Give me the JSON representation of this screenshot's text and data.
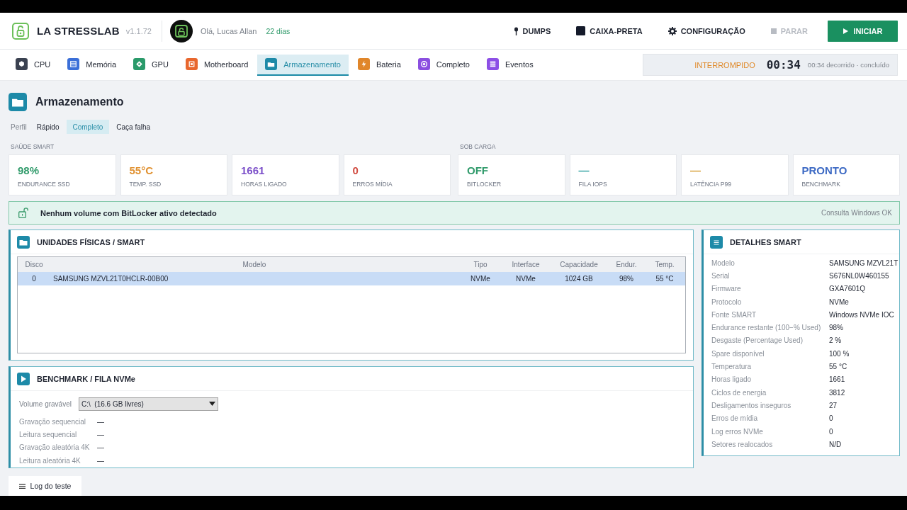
{
  "header": {
    "brand": {
      "name": "LA STRESSLAB",
      "version": "v1.1.72"
    },
    "user": {
      "greeting": "Olá, Lucas Allan",
      "days": "22 dias"
    },
    "actions": [
      {
        "label": "DUMPS",
        "disabled": false
      },
      {
        "label": "CAIXA-PRETA",
        "disabled": false
      },
      {
        "label": "CONFIGURAÇÃO",
        "disabled": false
      },
      {
        "label": "PARAR",
        "disabled": true
      }
    ],
    "start_button": "INICIAR"
  },
  "tabs": [
    {
      "label": "CPU",
      "color": "#3a4150",
      "selected": false
    },
    {
      "label": "Memória",
      "color": "#3b6fd8",
      "selected": false
    },
    {
      "label": "GPU",
      "color": "#2a9a6a",
      "selected": false
    },
    {
      "label": "Motherboard",
      "color": "#e8672e",
      "selected": false
    },
    {
      "label": "Armazenamento",
      "color": "#1d8aa8",
      "selected": true
    },
    {
      "label": "Bateria",
      "color": "#e0862a",
      "selected": false
    },
    {
      "label": "Completo",
      "color": "#8b4fe0",
      "selected": false
    },
    {
      "label": "Eventos",
      "color": "#8d4fe6",
      "selected": false
    }
  ],
  "run_status": {
    "state": "INTERROMPIDO",
    "timer": "00:34",
    "detail": "00:34 decorrido · concluído"
  },
  "page": {
    "title": "Armazenamento",
    "profile": {
      "label": "Perfil",
      "options": [
        {
          "label": "Rápido",
          "selected": false
        },
        {
          "label": "Completo",
          "selected": true
        },
        {
          "label": "Caça falha",
          "selected": false
        }
      ]
    }
  },
  "metric_groups": [
    {
      "label": "SAÚDE SMART",
      "metrics": [
        {
          "value": "98%",
          "label": "ENDURANCE SSD",
          "color": "#2f9a6a"
        },
        {
          "value": "55°C",
          "label": "TEMP. SSD",
          "color": "#e0902f"
        },
        {
          "value": "1661",
          "label": "HORAS LIGADO",
          "color": "#7b4fc9"
        },
        {
          "value": "0",
          "label": "ERROS MÍDIA",
          "color": "#d04a3f"
        }
      ]
    },
    {
      "label": "SOB CARGA",
      "metrics": [
        {
          "value": "OFF",
          "label": "BITLOCKER",
          "color": "#2f9a6a"
        },
        {
          "value": "—",
          "label": "FILA IOPS",
          "color": "#3aa6a6"
        },
        {
          "value": "—",
          "label": "LATÊNCIA P99",
          "color": "#d9a441"
        },
        {
          "value": "PRONTO",
          "label": "BENCHMARK",
          "color": "#3d6ac4"
        }
      ]
    }
  ],
  "banner": {
    "message": "Nenhum volume com BitLocker ativo detectado",
    "status": "Consulta Windows OK"
  },
  "drives_panel": {
    "title": "UNIDADES FÍSICAS / SMART",
    "columns": [
      "Disco",
      "Modelo",
      "Tipo",
      "Interface",
      "Capacidade",
      "Endur.",
      "Temp."
    ],
    "rows": [
      {
        "cells": [
          "0",
          "SAMSUNG MZVL21T0HCLR-00B00",
          "NVMe",
          "NVMe",
          "1024 GB",
          "98%",
          "55 °C"
        ],
        "selected": true
      }
    ]
  },
  "benchmark_panel": {
    "title": "BENCHMARK / FILA NVMe",
    "volume": {
      "label": "Volume gravável",
      "value": "C:\\  (16.6 GB livres)"
    },
    "results": [
      {
        "label": "Gravação sequencial",
        "value": "—"
      },
      {
        "label": "Leitura sequencial",
        "value": "—"
      },
      {
        "label": "Gravação aleatória 4K",
        "value": "—"
      },
      {
        "label": "Leitura aleatória 4K",
        "value": "—"
      }
    ]
  },
  "details_panel": {
    "title": "DETALHES SMART",
    "rows": [
      {
        "label": "Modelo",
        "value": "SAMSUNG MZVL21T"
      },
      {
        "label": "Serial",
        "value": "S676NL0W460155"
      },
      {
        "label": "Firmware",
        "value": "GXA7601Q"
      },
      {
        "label": "Protocolo",
        "value": "NVMe"
      },
      {
        "label": "Fonte SMART",
        "value": "Windows NVMe IOC"
      },
      {
        "label": "Endurance restante (100−% Used)",
        "value": "98%"
      },
      {
        "label": "Desgaste (Percentage Used)",
        "value": "2 %"
      },
      {
        "label": "Spare disponível",
        "value": "100 %"
      },
      {
        "label": "Temperatura",
        "value": "55 °C"
      },
      {
        "label": "Horas ligado",
        "value": "1661"
      },
      {
        "label": "Ciclos de energia",
        "value": "3812"
      },
      {
        "label": "Desligamentos inseguros",
        "value": "27"
      },
      {
        "label": "Erros de mídia",
        "value": "0"
      },
      {
        "label": "Log erros NVMe",
        "value": "0"
      },
      {
        "label": "Setores realocados",
        "value": "N/D"
      }
    ]
  },
  "log_button": "Log do teste"
}
